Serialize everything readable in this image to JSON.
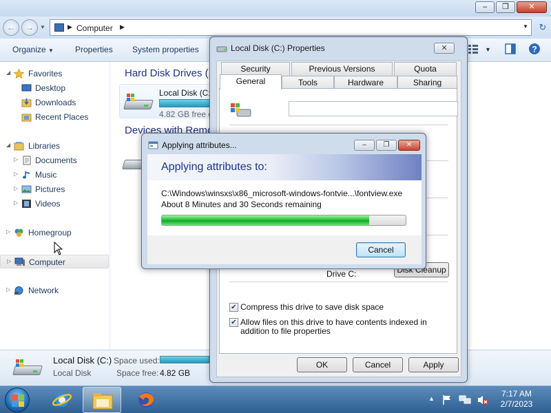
{
  "address": {
    "crumb": "Computer"
  },
  "toolbar": {
    "organize": "Organize",
    "properties": "Properties",
    "system_properties": "System properties"
  },
  "nav": {
    "favorites": "Favorites",
    "desktop": "Desktop",
    "downloads": "Downloads",
    "recent_places": "Recent Places",
    "libraries": "Libraries",
    "documents": "Documents",
    "music": "Music",
    "pictures": "Pictures",
    "videos": "Videos",
    "homegroup": "Homegroup",
    "computer": "Computer",
    "network": "Network"
  },
  "content": {
    "hard_disk_header": "Hard Disk Drives (1",
    "devices_header": "Devices with Remo",
    "drive_name": "Local Disk (C:",
    "drive_free": "4.82 GB free o"
  },
  "details": {
    "name": "Local Disk (C:)",
    "type": "Local Disk",
    "space_used_label": "Space used:",
    "space_free_label": "Space free:",
    "space_free_value": "4.82 GB"
  },
  "properties_dialog": {
    "title": "Local Disk (C:) Properties",
    "tabs_top": [
      "Security",
      "Previous Versions",
      "Quota"
    ],
    "tabs_bottom": [
      "General",
      "Tools",
      "Hardware",
      "Sharing"
    ],
    "drive_c_label": "Drive C:",
    "disk_cleanup": "Disk Cleanup",
    "compress_label": "Compress this drive to save disk space",
    "index_label": "Allow files on this drive to have contents indexed in addition to file properties",
    "ok": "OK",
    "cancel": "Cancel",
    "apply": "Apply"
  },
  "apply_dialog": {
    "title": "Applying attributes...",
    "heading": "Applying attributes to:",
    "path": "C:\\Windows\\winsxs\\x86_microsoft-windows-fontvie...\\fontview.exe",
    "remaining": "About 8 Minutes and 30 Seconds remaining",
    "progress_percent": 85,
    "cancel": "Cancel"
  },
  "taskbar": {
    "time": "7:17 AM",
    "date": "2/7/2023"
  }
}
